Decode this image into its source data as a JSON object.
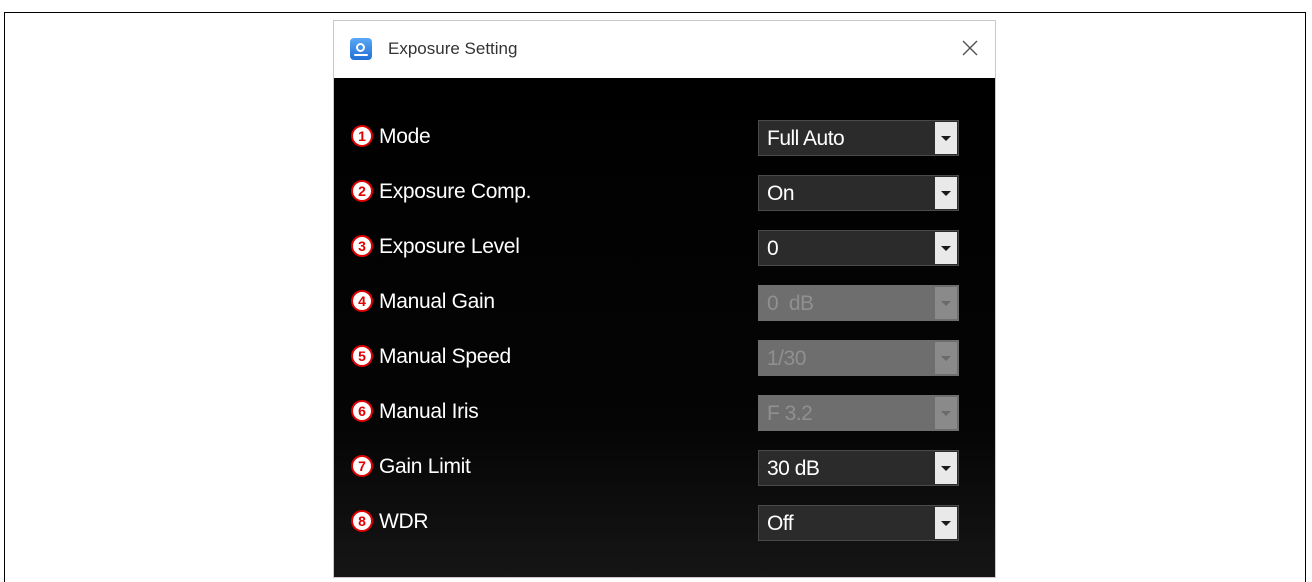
{
  "window": {
    "title": "Exposure Setting",
    "icon": "camera-app-icon",
    "close_icon": "close-icon"
  },
  "settings": [
    {
      "number": "1",
      "label": "Mode",
      "value": "Full Auto",
      "enabled": true
    },
    {
      "number": "2",
      "label": "Exposure Comp.",
      "value": "On",
      "enabled": true
    },
    {
      "number": "3",
      "label": "Exposure Level",
      "value": "0",
      "enabled": true
    },
    {
      "number": "4",
      "label": "Manual Gain",
      "value": "0  dB",
      "enabled": false
    },
    {
      "number": "5",
      "label": "Manual Speed",
      "value": "1/30",
      "enabled": false
    },
    {
      "number": "6",
      "label": "Manual Iris",
      "value": "F 3.2",
      "enabled": false
    },
    {
      "number": "7",
      "label": "Gain Limit",
      "value": "30 dB",
      "enabled": true
    },
    {
      "number": "8",
      "label": "WDR",
      "value": "Off",
      "enabled": true
    }
  ],
  "colors": {
    "badge": "#e00000",
    "panel_background": "#000000",
    "dropdown_background": "#2b2b2b",
    "dropdown_disabled": "#6e6e6e"
  }
}
